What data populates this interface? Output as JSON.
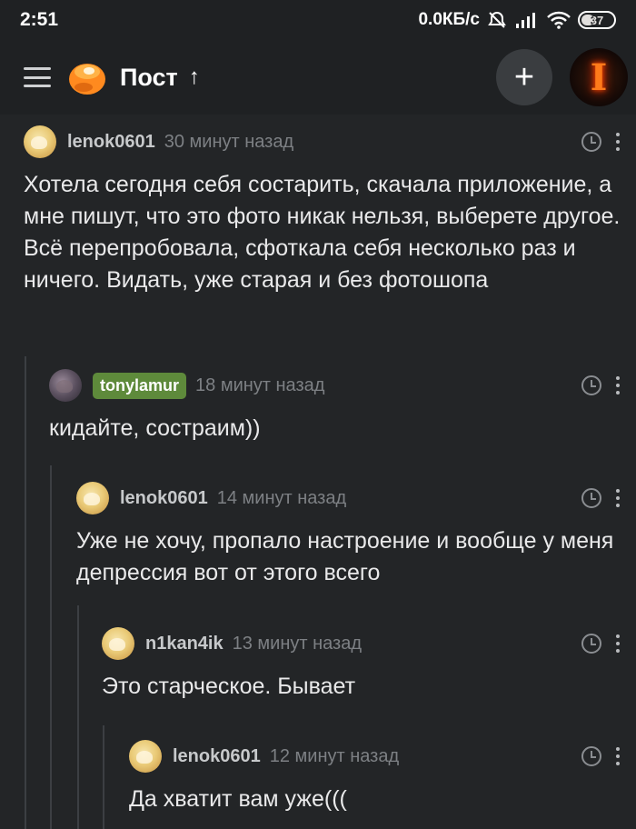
{
  "status_bar": {
    "time": "2:51",
    "net_speed": "0.0КБ/с",
    "battery": "37"
  },
  "header": {
    "title": "Пост",
    "arrow": "↑",
    "plus": "+",
    "avatar_letter": "I"
  },
  "comments": [
    {
      "user": "lenok0601",
      "time": "30 минут назад",
      "text": "Хотела сегодня себя состарить, скачала приложение, а мне пишут, что это фото никак нельзя, выберете другое. Всё перепробовала, сфоткала себя несколько раз и ничего. Видать, уже старая и без фотошопа"
    },
    {
      "user": "tonylamur",
      "time": "18 минут назад",
      "text": "кидайте, состраим))"
    },
    {
      "user": "lenok0601",
      "time": "14 минут назад",
      "text": "Уже не хочу, пропало настроение и вообще у меня депрессия вот от этого всего"
    },
    {
      "user": "n1kan4ik",
      "time": "13 минут назад",
      "text": "Это старческое. Бывает"
    },
    {
      "user": "lenok0601",
      "time": "12 минут назад",
      "text": "Да хватит вам уже((("
    }
  ]
}
